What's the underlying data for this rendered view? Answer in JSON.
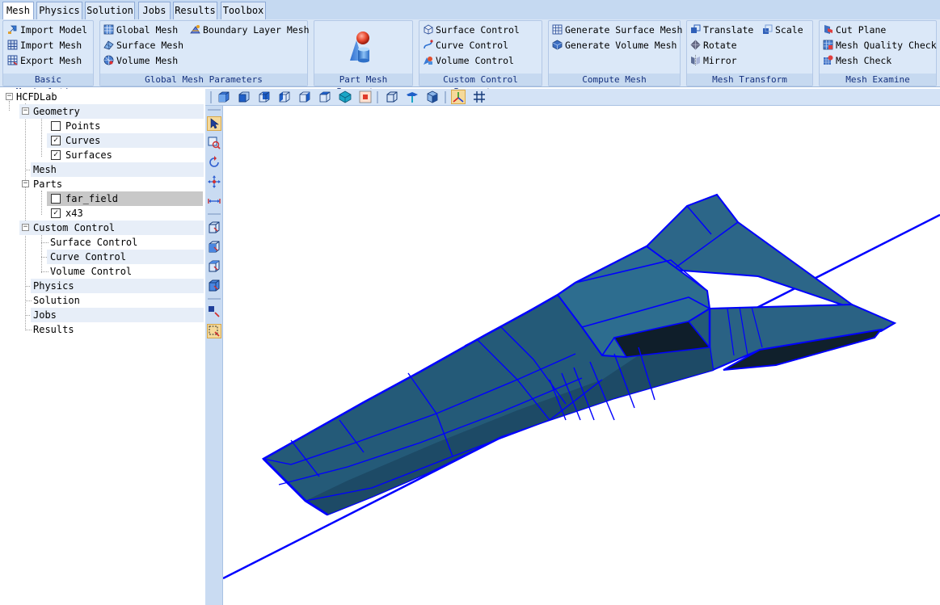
{
  "tabs": [
    {
      "label": "Mesh",
      "active": true
    },
    {
      "label": "Physics"
    },
    {
      "label": "Solution"
    },
    {
      "label": "Jobs"
    },
    {
      "label": "Results"
    },
    {
      "label": "Toolbox"
    }
  ],
  "ribbon": {
    "basic": {
      "label": "Basic Manipulation",
      "import_model": "Import Model",
      "import_mesh": "Import Mesh",
      "export_mesh": "Export Mesh"
    },
    "global": {
      "label": "Global Mesh Parameters",
      "global_mesh": "Global Mesh",
      "surface_mesh": "Surface Mesh",
      "volume_mesh": "Volume Mesh",
      "boundary_layer_mesh": "Boundary Layer Mesh"
    },
    "part": {
      "label": "Part Mesh Parameters"
    },
    "custom": {
      "label": "Custom Control Parameters",
      "surface_control": "Surface Control",
      "curve_control": "Curve Control",
      "volume_control": "Volume Control"
    },
    "compute": {
      "label": "Compute Mesh",
      "generate_surface_mesh": "Generate Surface Mesh",
      "generate_volume_mesh": "Generate Volume Mesh"
    },
    "transform": {
      "label": "Mesh Transform",
      "translate": "Translate",
      "scale": "Scale",
      "rotate": "Rotate",
      "mirror": "Mirror"
    },
    "examine": {
      "label": "Mesh Examine",
      "cut_plane": "Cut Plane",
      "mesh_quality_check": "Mesh Quality Check",
      "mesh_check": "Mesh Check"
    }
  },
  "tree": {
    "root": "HCFDLab",
    "geometry": "Geometry",
    "points": "Points",
    "points_checked": false,
    "curves": "Curves",
    "curves_checked": true,
    "surfaces": "Surfaces",
    "surfaces_checked": true,
    "mesh": "Mesh",
    "parts": "Parts",
    "far_field": "far_field",
    "far_field_checked": false,
    "x43": "x43",
    "x43_checked": true,
    "custom_control": "Custom Control",
    "surface_control": "Surface Control",
    "curve_control": "Curve Control",
    "volume_control": "Volume Control",
    "physics": "Physics",
    "solution": "Solution",
    "jobs": "Jobs",
    "results": "Results"
  },
  "colors": {
    "model_fill": "#245a78",
    "model_fill_dark": "#1b4560",
    "model_fill_light": "#2c6a8a",
    "edge": "#0000ff",
    "cavity": "#0f1e2a",
    "ribbon_bg": "#d9e6f6",
    "tab_bg": "#c5d9f1"
  },
  "icons": {
    "h_toolbar": [
      "view-iso-icon",
      "view-front-icon",
      "view-back-icon",
      "view-left-icon",
      "view-right-icon",
      "view-top-icon",
      "view-bottom-icon",
      "view-fit-icon",
      "wireframe-icon",
      "surface-edge-icon",
      "shaded-icon",
      "axis-icon",
      "grid-icon"
    ],
    "v_toolbar": [
      "select-arrow-icon",
      "zoom-box-icon",
      "rotate-icon",
      "pan-icon",
      "measure-icon",
      "box-select-1-icon",
      "box-select-2-icon",
      "box-select-3-icon",
      "box-select-4-icon",
      "pick-point-icon",
      "select-area-icon"
    ]
  }
}
